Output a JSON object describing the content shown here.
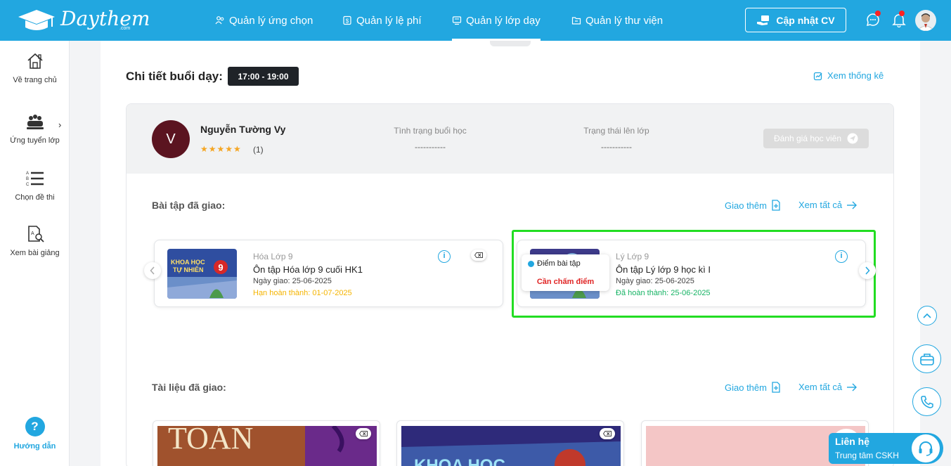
{
  "brand": {
    "name": "Daythem",
    "suffix": ".com"
  },
  "nav": [
    {
      "label": "Quản lý ứng chọn",
      "icon": "users-icon"
    },
    {
      "label": "Quản lý lệ phí",
      "icon": "fee-icon"
    },
    {
      "label": "Quản lý lớp dạy",
      "icon": "classroom-icon",
      "active": true
    },
    {
      "label": "Quản lý thư viện",
      "icon": "library-icon"
    }
  ],
  "header": {
    "cv_button": "Cập nhật CV"
  },
  "sidebar": {
    "items": [
      {
        "label": "Về trang chủ",
        "icon": "home-icon"
      },
      {
        "label": "Ứng tuyển lớp",
        "icon": "group-icon"
      },
      {
        "label": "Chọn đề thi",
        "icon": "exam-list-icon"
      },
      {
        "label": "Xem bài giảng",
        "icon": "lesson-search-icon"
      }
    ],
    "help_label": "Hướng dẫn",
    "help_symbol": "?"
  },
  "page": {
    "title": "Chi tiết buổi dạy:",
    "time": "17:00 - 19:00",
    "stats_link": "Xem thống kê"
  },
  "student": {
    "initial": "V",
    "name": "Nguyễn Tường Vy",
    "stars": "★★★★★",
    "rating_count": "(1)",
    "session_status_label": "Tình trạng buổi học",
    "session_status_value": "-----------",
    "attendance_label": "Trạng thái lên lớp",
    "attendance_value": "-----------",
    "rate_button": "Đánh giá học viên"
  },
  "assignments": {
    "title": "Bài tập đã giao:",
    "add_more": "Giao thêm",
    "view_all": "Xem tất cả",
    "cards": [
      {
        "subject": "Hóa Lớp 9",
        "title": "Ôn tập Hóa lớp 9 cuối HK1",
        "date": "Ngày giao: 25-06-2025",
        "status": "Hạn hoàn thành: 01-07-2025",
        "status_color": "#f5b400",
        "thumb_text1": "KHOA HỌC",
        "thumb_text2": "TỰ NHIÊN",
        "thumb_num": "9"
      },
      {
        "subject": "Lý Lớp 9",
        "title": "Ôn tập Lý lớp 9 học kì I",
        "date": "Ngày giao: 25-06-2025",
        "status": "Đã hoàn thành: 25-06-2025",
        "status_color": "#16b364"
      }
    ],
    "popover": {
      "item": "Điểm bài tập",
      "warning": "Cần chấm điểm"
    }
  },
  "documents": {
    "title": "Tài liệu đã giao:",
    "add_more": "Giao thêm",
    "view_all": "Xem tất cả",
    "thumb_text1": "TOÁN",
    "thumb_text2": "KHOA HỌC"
  },
  "support": {
    "title": "Liên hệ",
    "subtitle": "Trung tâm CSKH"
  }
}
